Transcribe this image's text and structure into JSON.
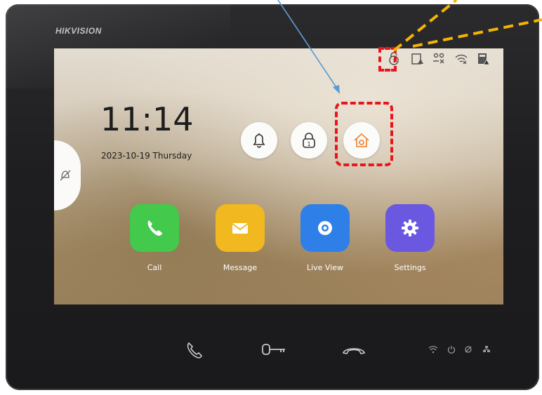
{
  "device": {
    "brand": "HIKVISION"
  },
  "home": {
    "time": "11:14",
    "date": "2023-10-19 Thursday"
  },
  "status_bar": {
    "icons": [
      "unlock-status-icon",
      "card-alert-icon",
      "network-disconnected-icon",
      "wifi-off-icon",
      "sd-card-alert-icon"
    ]
  },
  "side_tab": {
    "icon": "disturb-off-icon"
  },
  "quick_actions": [
    {
      "name": "alarm-bell",
      "icon": "bell-icon"
    },
    {
      "name": "unlock",
      "icon": "lock-1-icon"
    },
    {
      "name": "home-arming",
      "icon": "home-icon"
    }
  ],
  "apps": [
    {
      "label": "Call",
      "icon": "phone-icon",
      "color": "#43c94b"
    },
    {
      "label": "Message",
      "icon": "envelope-icon",
      "color": "#f2b820"
    },
    {
      "label": "Live View",
      "icon": "camera-icon",
      "color": "#2f7fe8"
    },
    {
      "label": "Settings",
      "icon": "gear-icon",
      "color": "#6a58e0"
    }
  ],
  "hardware_buttons": [
    "answer-icon",
    "unlock-key-icon",
    "hangup-icon"
  ],
  "indicators": [
    "wifi-led-icon",
    "power-led-icon",
    "mute-led-icon",
    "network-led-icon"
  ],
  "annotations": {
    "highlight_color": "#e8161c",
    "pointer_color": "#5b9bd5",
    "guide_color": "#f5b400"
  }
}
